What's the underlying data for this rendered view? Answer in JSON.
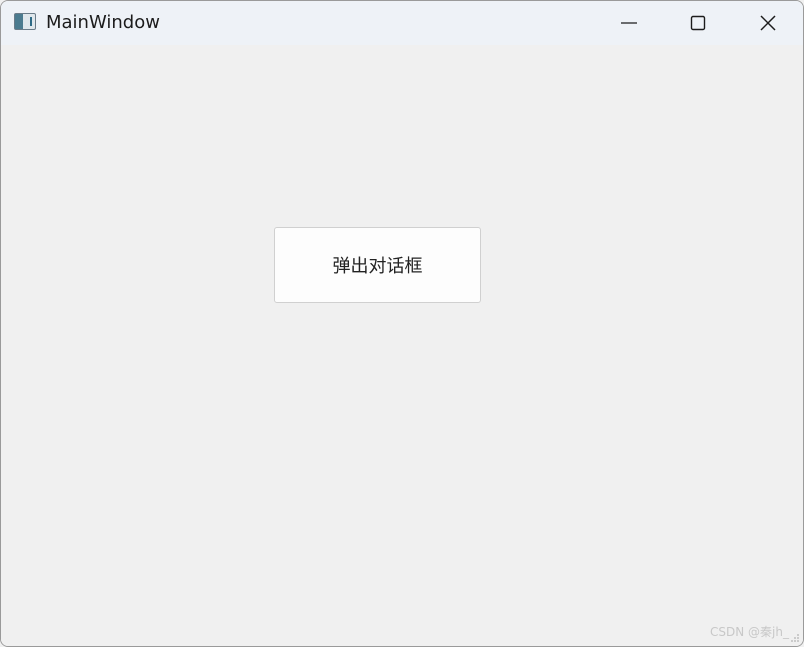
{
  "window": {
    "title": "MainWindow",
    "icon": "app-window-icon"
  },
  "titlebar_controls": {
    "minimize_icon": "minimize-icon",
    "maximize_icon": "maximize-icon",
    "close_icon": "close-icon"
  },
  "main": {
    "popup_button_label": "弹出对话框"
  },
  "watermark": {
    "text": "CSDN @秦jh_"
  },
  "colors": {
    "titlebar_bg": "#eef2f7",
    "content_bg": "#f0f0f0",
    "button_bg": "#fdfdfd",
    "button_border": "#d0d0d0"
  }
}
